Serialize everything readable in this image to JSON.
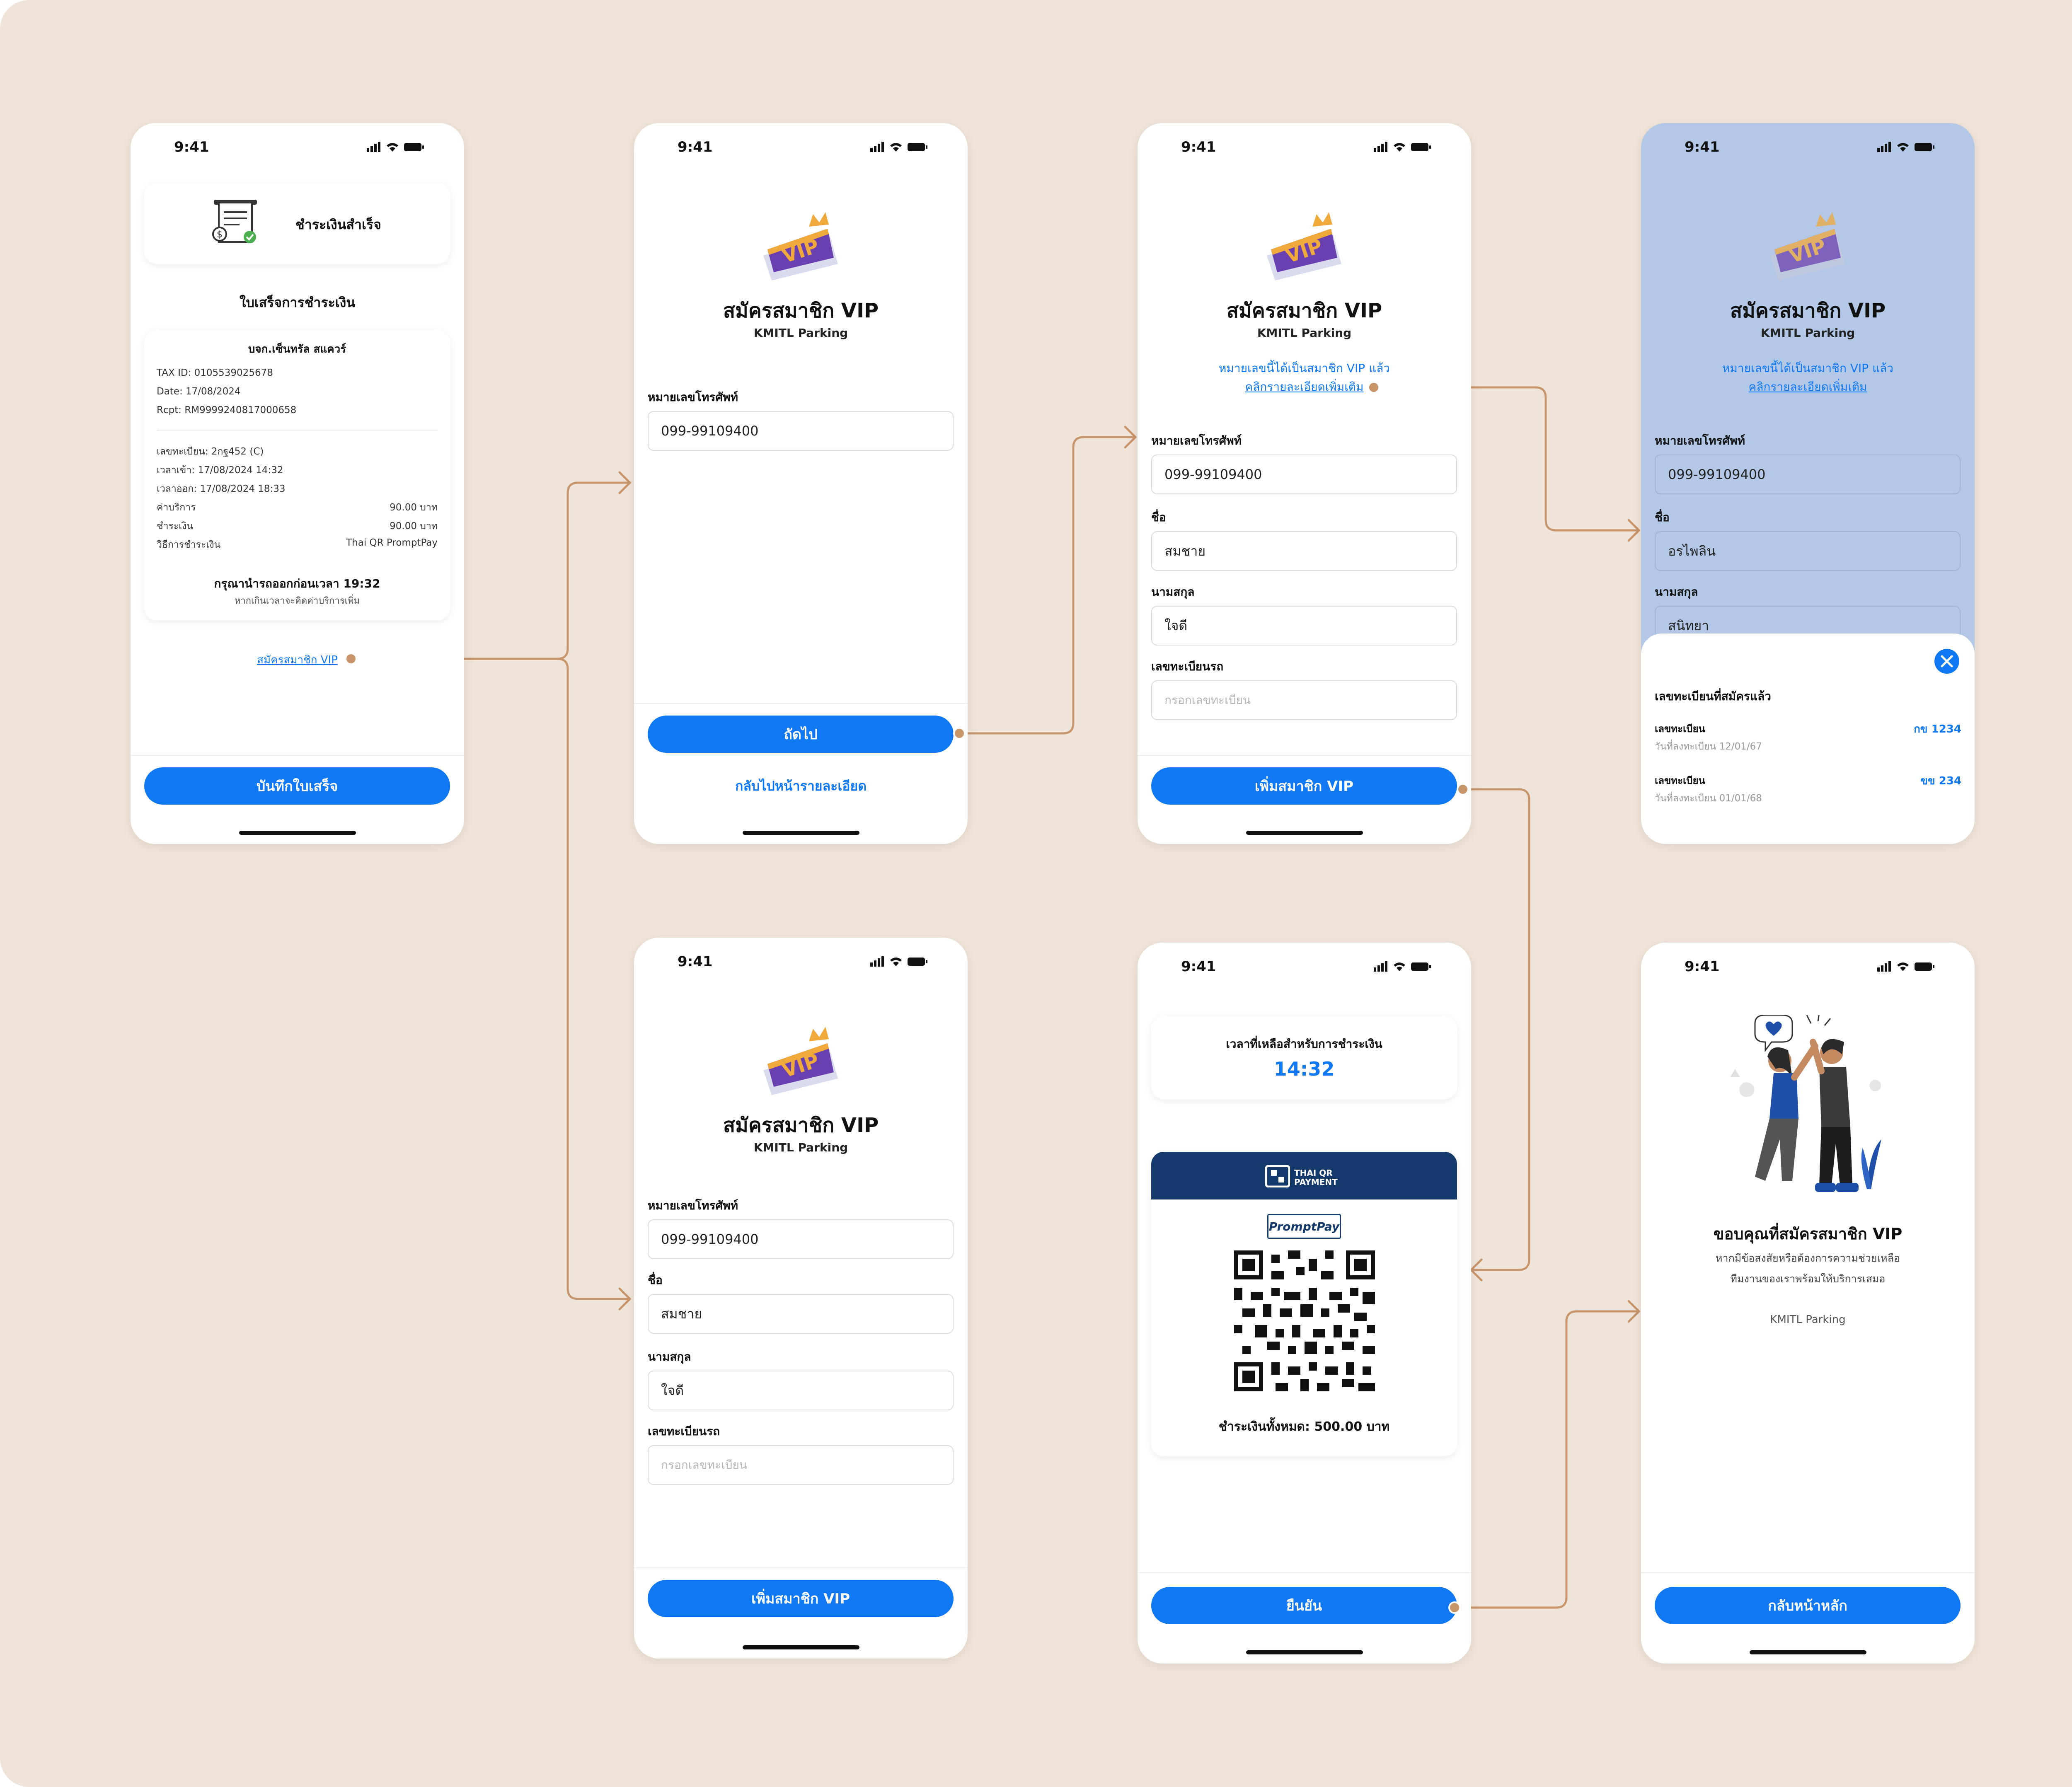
{
  "status_time": "9:41",
  "screen1": {
    "card_title": "ชำระเงินสำเร็จ",
    "receipt_heading": "ใบเสร็จการชำระเงิน",
    "company": "บจก.เซ็นทรัล สแควร์",
    "tax_id": "TAX ID: 0105539025678",
    "date": "Date: 17/08/2024",
    "rcpt": "Rcpt: RM9999240817000658",
    "plate": "เลขทะเบียน: 2กฐ452 (C)",
    "time_in": "เวลาเข้า: 17/08/2024 14:32",
    "time_out": "เวลาออก: 17/08/2024 18:33",
    "rows": [
      {
        "label": "ค่าบริการ",
        "value": "90.00 บาท"
      },
      {
        "label": "ชำระเงิน",
        "value": "90.00 บาท"
      },
      {
        "label": "วิธีการชำระเงิน",
        "value": "Thai QR PromptPay"
      }
    ],
    "exit_notice": "กรุณานำรถออกก่อนเวลา 19:32",
    "exit_sub": "หากเกินเวลาจะคิดค่าบริการเพิ่ม",
    "vip_link": "สมัครสมาชิก VIP",
    "save_button": "บันทึกใบเสร็จ"
  },
  "screen2": {
    "title": "สมัครสมาชิก VIP",
    "subtitle": "KMITL Parking",
    "phone_label": "หมายเลขโทรศัพท์",
    "phone_value": "099-99109400",
    "next_button": "ถัดไป",
    "back_link": "กลับไปหน้ารายละเอียด"
  },
  "screen3": {
    "title": "สมัครสมาชิก VIP",
    "subtitle": "KMITL Parking",
    "notice": "หมายเลขนี้ได้เป็นสมาชิก VIP แล้ว",
    "notice_link": "คลิกรายละเอียดเพิ่มเติม",
    "phone_label": "หมายเลขโทรศัพท์",
    "phone_value": "099-99109400",
    "first_label": "ชื่อ",
    "first_value": "สมชาย",
    "last_label": "นามสกุล",
    "last_value": "ใจดี",
    "plate_label": "เลขทะเบียนรถ",
    "plate_placeholder": "กรอกเลขทะเบียน",
    "add_button": "เพิ่มสมาชิก VIP"
  },
  "screen4": {
    "title": "สมัครสมาชิก VIP",
    "subtitle": "KMITL Parking",
    "notice": "หมายเลขนี้ได้เป็นสมาชิก VIP แล้ว",
    "notice_link": "คลิกรายละเอียดเพิ่มเติม",
    "phone_label": "หมายเลขโทรศัพท์",
    "phone_value": "099-99109400",
    "first_label": "ชื่อ",
    "first_value": "อรไพลิน",
    "last_label": "นามสกุล",
    "last_value": "สนิทยา",
    "sheet_title": "เลขทะเบียนที่สมัครแล้ว",
    "plates": [
      {
        "label": "เลขทะเบียน",
        "date": "วันที่ลงทะเบียน  12/01/67",
        "value": "กข 1234"
      },
      {
        "label": "เลขทะเบียน",
        "date": "วันที่ลงทะเบียน  01/01/68",
        "value": "ขข 234"
      }
    ]
  },
  "screen5": {
    "title": "สมัครสมาชิก VIP",
    "subtitle": "KMITL Parking",
    "phone_label": "หมายเลขโทรศัพท์",
    "phone_value": "099-99109400",
    "first_label": "ชื่อ",
    "first_value": "สมชาย",
    "last_label": "นามสกุล",
    "last_value": "ใจดี",
    "plate_label": "เลขทะเบียนรถ",
    "plate_placeholder": "กรอกเลขทะเบียน",
    "add_button": "เพิ่มสมาชิก VIP"
  },
  "screen6": {
    "timer_label": "เวลาที่เหลือสำหรับการชำระเงิน",
    "timer_value": "14:32",
    "qr_brand": "THAI QR PAYMENT",
    "promptpay": "PromptPay",
    "total": "ชำระเงินทั้งหมด: 500.00 บาท",
    "confirm_button": "ยืนยัน"
  },
  "screen7": {
    "thanks": "ขอบคุณที่สมัครสมาชิก VIP",
    "help_1": "หากมีข้อสงสัยหรือต้องการความช่วยเหลือ",
    "help_2": "ทีมงานของเราพร้อมให้บริการเสมอ",
    "brand": "KMITL Parking",
    "home_button": "กลับหน้าหลัก"
  },
  "colors": {
    "background": "#efe4d9",
    "primary": "#1078f3",
    "connector": "#c8946a",
    "overlay": "#b3c7e6",
    "qr_header": "#143a6b"
  }
}
